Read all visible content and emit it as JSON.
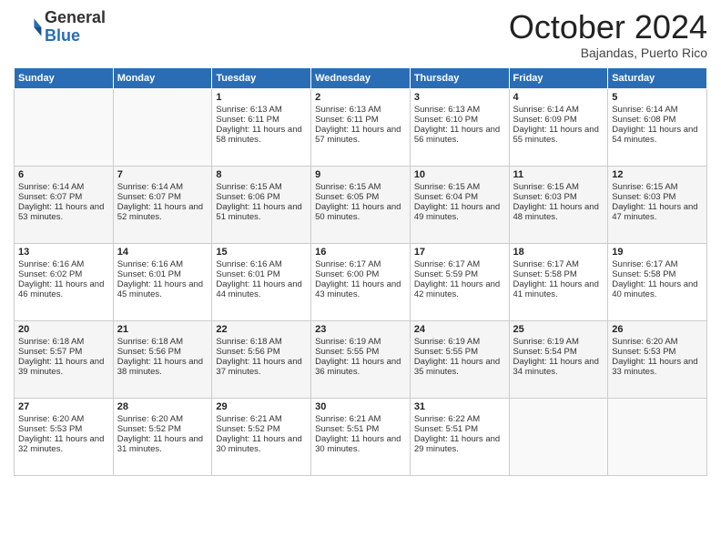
{
  "header": {
    "logo_general": "General",
    "logo_blue": "Blue",
    "month_title": "October 2024",
    "subtitle": "Bajandas, Puerto Rico"
  },
  "days_of_week": [
    "Sunday",
    "Monday",
    "Tuesday",
    "Wednesday",
    "Thursday",
    "Friday",
    "Saturday"
  ],
  "weeks": [
    [
      {
        "day": "",
        "content": ""
      },
      {
        "day": "",
        "content": ""
      },
      {
        "day": "1",
        "content": "Sunrise: 6:13 AM\nSunset: 6:11 PM\nDaylight: 11 hours and 58 minutes."
      },
      {
        "day": "2",
        "content": "Sunrise: 6:13 AM\nSunset: 6:11 PM\nDaylight: 11 hours and 57 minutes."
      },
      {
        "day": "3",
        "content": "Sunrise: 6:13 AM\nSunset: 6:10 PM\nDaylight: 11 hours and 56 minutes."
      },
      {
        "day": "4",
        "content": "Sunrise: 6:14 AM\nSunset: 6:09 PM\nDaylight: 11 hours and 55 minutes."
      },
      {
        "day": "5",
        "content": "Sunrise: 6:14 AM\nSunset: 6:08 PM\nDaylight: 11 hours and 54 minutes."
      }
    ],
    [
      {
        "day": "6",
        "content": "Sunrise: 6:14 AM\nSunset: 6:07 PM\nDaylight: 11 hours and 53 minutes."
      },
      {
        "day": "7",
        "content": "Sunrise: 6:14 AM\nSunset: 6:07 PM\nDaylight: 11 hours and 52 minutes."
      },
      {
        "day": "8",
        "content": "Sunrise: 6:15 AM\nSunset: 6:06 PM\nDaylight: 11 hours and 51 minutes."
      },
      {
        "day": "9",
        "content": "Sunrise: 6:15 AM\nSunset: 6:05 PM\nDaylight: 11 hours and 50 minutes."
      },
      {
        "day": "10",
        "content": "Sunrise: 6:15 AM\nSunset: 6:04 PM\nDaylight: 11 hours and 49 minutes."
      },
      {
        "day": "11",
        "content": "Sunrise: 6:15 AM\nSunset: 6:03 PM\nDaylight: 11 hours and 48 minutes."
      },
      {
        "day": "12",
        "content": "Sunrise: 6:15 AM\nSunset: 6:03 PM\nDaylight: 11 hours and 47 minutes."
      }
    ],
    [
      {
        "day": "13",
        "content": "Sunrise: 6:16 AM\nSunset: 6:02 PM\nDaylight: 11 hours and 46 minutes."
      },
      {
        "day": "14",
        "content": "Sunrise: 6:16 AM\nSunset: 6:01 PM\nDaylight: 11 hours and 45 minutes."
      },
      {
        "day": "15",
        "content": "Sunrise: 6:16 AM\nSunset: 6:01 PM\nDaylight: 11 hours and 44 minutes."
      },
      {
        "day": "16",
        "content": "Sunrise: 6:17 AM\nSunset: 6:00 PM\nDaylight: 11 hours and 43 minutes."
      },
      {
        "day": "17",
        "content": "Sunrise: 6:17 AM\nSunset: 5:59 PM\nDaylight: 11 hours and 42 minutes."
      },
      {
        "day": "18",
        "content": "Sunrise: 6:17 AM\nSunset: 5:58 PM\nDaylight: 11 hours and 41 minutes."
      },
      {
        "day": "19",
        "content": "Sunrise: 6:17 AM\nSunset: 5:58 PM\nDaylight: 11 hours and 40 minutes."
      }
    ],
    [
      {
        "day": "20",
        "content": "Sunrise: 6:18 AM\nSunset: 5:57 PM\nDaylight: 11 hours and 39 minutes."
      },
      {
        "day": "21",
        "content": "Sunrise: 6:18 AM\nSunset: 5:56 PM\nDaylight: 11 hours and 38 minutes."
      },
      {
        "day": "22",
        "content": "Sunrise: 6:18 AM\nSunset: 5:56 PM\nDaylight: 11 hours and 37 minutes."
      },
      {
        "day": "23",
        "content": "Sunrise: 6:19 AM\nSunset: 5:55 PM\nDaylight: 11 hours and 36 minutes."
      },
      {
        "day": "24",
        "content": "Sunrise: 6:19 AM\nSunset: 5:55 PM\nDaylight: 11 hours and 35 minutes."
      },
      {
        "day": "25",
        "content": "Sunrise: 6:19 AM\nSunset: 5:54 PM\nDaylight: 11 hours and 34 minutes."
      },
      {
        "day": "26",
        "content": "Sunrise: 6:20 AM\nSunset: 5:53 PM\nDaylight: 11 hours and 33 minutes."
      }
    ],
    [
      {
        "day": "27",
        "content": "Sunrise: 6:20 AM\nSunset: 5:53 PM\nDaylight: 11 hours and 32 minutes."
      },
      {
        "day": "28",
        "content": "Sunrise: 6:20 AM\nSunset: 5:52 PM\nDaylight: 11 hours and 31 minutes."
      },
      {
        "day": "29",
        "content": "Sunrise: 6:21 AM\nSunset: 5:52 PM\nDaylight: 11 hours and 30 minutes."
      },
      {
        "day": "30",
        "content": "Sunrise: 6:21 AM\nSunset: 5:51 PM\nDaylight: 11 hours and 30 minutes."
      },
      {
        "day": "31",
        "content": "Sunrise: 6:22 AM\nSunset: 5:51 PM\nDaylight: 11 hours and 29 minutes."
      },
      {
        "day": "",
        "content": ""
      },
      {
        "day": "",
        "content": ""
      }
    ]
  ]
}
